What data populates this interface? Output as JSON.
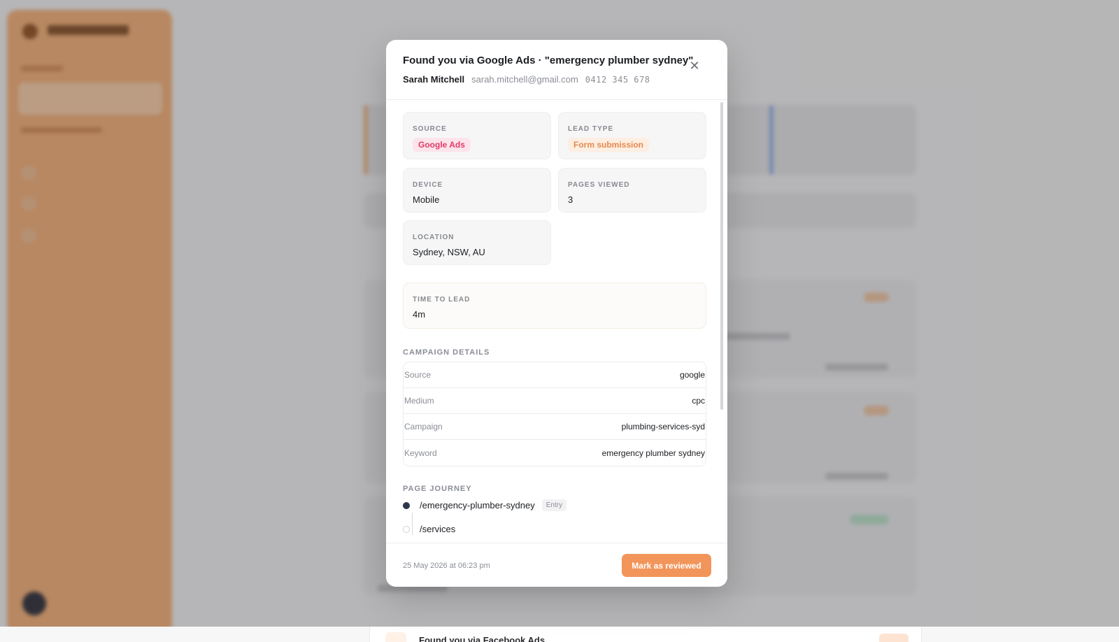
{
  "modal": {
    "title": "Found you via Google Ads · \"emergency plumber sydney\"",
    "contact": {
      "name": "Sarah Mitchell",
      "email": "sarah.mitchell@gmail.com",
      "phone": "0412 345 678"
    },
    "details": {
      "source": {
        "label": "SOURCE",
        "value": "Google Ads",
        "color": "#e13a6a"
      },
      "lead_type": {
        "label": "LEAD TYPE",
        "value": "Form submission",
        "color": "#e5894e"
      },
      "device": {
        "label": "DEVICE",
        "value": "Mobile"
      },
      "pages_viewed": {
        "label": "PAGES VIEWED",
        "value": "3"
      },
      "location": {
        "label": "LOCATION",
        "value": "Sydney, NSW, AU"
      },
      "time_to_lead": {
        "label": "TIME TO LEAD",
        "value": "4m"
      }
    },
    "campaign": {
      "title": "CAMPAIGN DETAILS",
      "rows": [
        {
          "key": "Source",
          "value": "google"
        },
        {
          "key": "Medium",
          "value": "cpc"
        },
        {
          "key": "Campaign",
          "value": "plumbing-services-syd"
        },
        {
          "key": "Keyword",
          "value": "emergency plumber sydney"
        }
      ]
    },
    "journey": {
      "title": "PAGE JOURNEY",
      "entry_badge": "Entry",
      "pages": [
        {
          "path": "/emergency-plumber-sydney"
        },
        {
          "path": "/services"
        }
      ]
    },
    "footer": {
      "date": "25 May 2026 at 06:23 pm",
      "button": "Mark as reviewed"
    }
  },
  "background": {
    "peek_text": "Found you via Facebook Ads"
  },
  "colors": {
    "accent": "#f2955a",
    "sidebar": "#f6b47e"
  }
}
